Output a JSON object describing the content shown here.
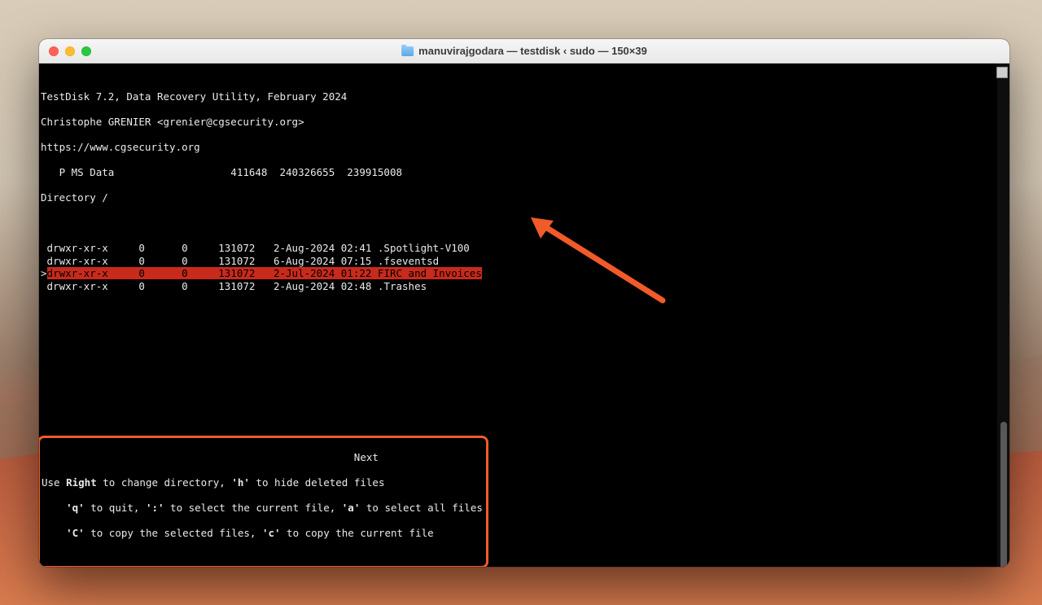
{
  "window": {
    "title": "manuvirajgodara — testdisk ‹ sudo — 150×39"
  },
  "header": {
    "line1": "TestDisk 7.2, Data Recovery Utility, February 2024",
    "line2": "Christophe GRENIER <grenier@cgsecurity.org>",
    "line3": "https://www.cgsecurity.org"
  },
  "partition": {
    "line": "   P MS Data                   411648  240326655  239915008"
  },
  "directory_label": "Directory /",
  "rows": [
    {
      "perm": " drwxr-xr-x",
      "uid": "0",
      "gid": "0",
      "size": "131072",
      "date": " 2-Aug-2024 02:41",
      "name": ".Spotlight-V100",
      "selected": false
    },
    {
      "perm": " drwxr-xr-x",
      "uid": "0",
      "gid": "0",
      "size": "131072",
      "date": " 6-Aug-2024 07:15",
      "name": ".fseventsd",
      "selected": false
    },
    {
      "perm": " drwxr-xr-x",
      "uid": "0",
      "gid": "0",
      "size": "131072",
      "date": " 2-Jul-2024 01:22",
      "name": "FIRC and Invoices",
      "selected": true
    },
    {
      "perm": " drwxr-xr-x",
      "uid": "0",
      "gid": "0",
      "size": "131072",
      "date": " 2-Aug-2024 02:48",
      "name": ".Trashes",
      "selected": false
    }
  ],
  "next_label": "                                                   Next",
  "help": {
    "l1_a": "Use ",
    "l1_b": "Right",
    "l1_c": " to change directory, ",
    "l1_d": "'h'",
    "l1_e": " to hide deleted files",
    "l2_a": "    ",
    "l2_b": "'q'",
    "l2_c": " to quit, ",
    "l2_d": "':'",
    "l2_e": " to select the current file, ",
    "l2_f": "'a'",
    "l2_g": " to select all files",
    "l3_a": "    ",
    "l3_b": "'C'",
    "l3_c": " to copy the selected files, ",
    "l3_d": "'c'",
    "l3_e": " to copy the current file"
  }
}
